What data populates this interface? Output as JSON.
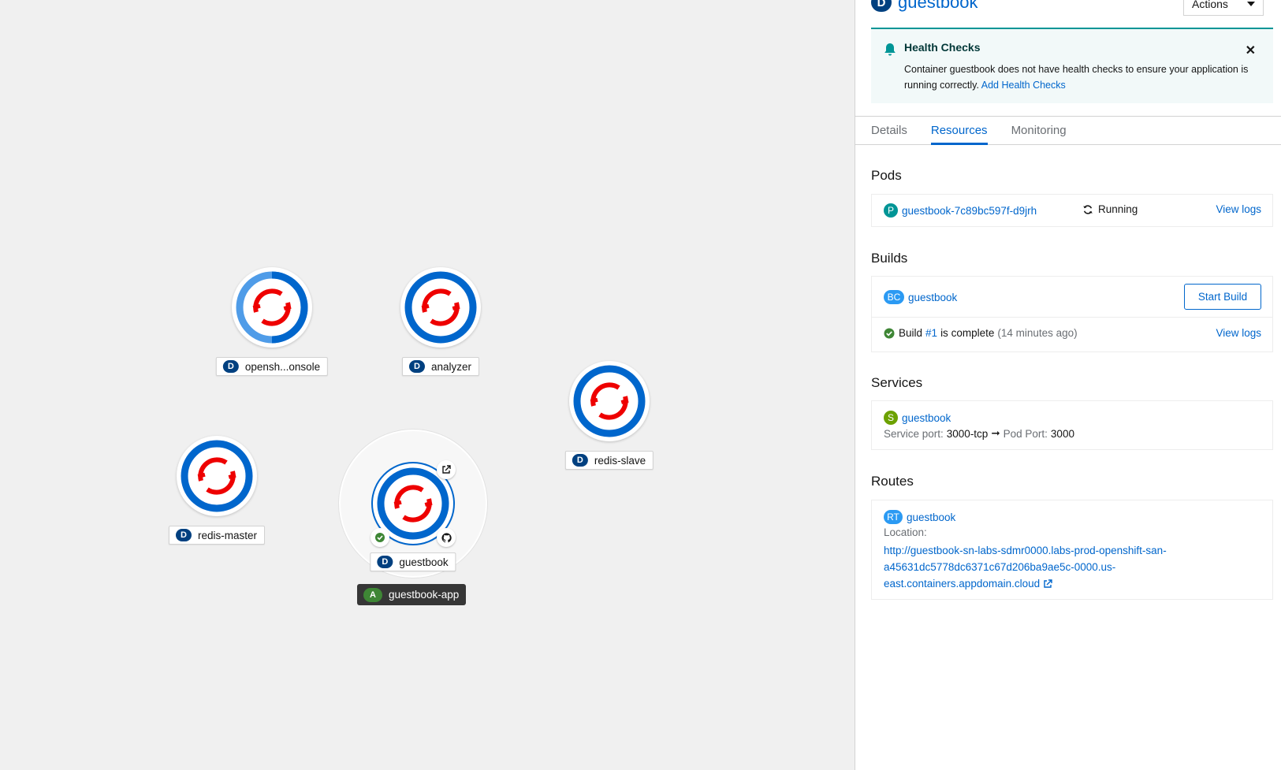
{
  "topology": {
    "nodes": [
      {
        "id": "openshift-console",
        "badge": "D",
        "label": "opensh...onsole"
      },
      {
        "id": "analyzer",
        "badge": "D",
        "label": "analyzer"
      },
      {
        "id": "redis-slave",
        "badge": "D",
        "label": "redis-slave"
      },
      {
        "id": "redis-master",
        "badge": "D",
        "label": "redis-master"
      },
      {
        "id": "guestbook",
        "badge": "D",
        "label": "guestbook"
      }
    ],
    "application": {
      "badge": "A",
      "label": "guestbook-app"
    }
  },
  "panel": {
    "title_badge": "D",
    "title": "guestbook",
    "actions_label": "Actions",
    "alert": {
      "title": "Health Checks",
      "body": "Container guestbook does not have health checks to ensure your application is running correctly.",
      "link": "Add Health Checks"
    },
    "tabs": [
      {
        "label": "Details",
        "active": false
      },
      {
        "label": "Resources",
        "active": true
      },
      {
        "label": "Monitoring",
        "active": false
      }
    ],
    "pods": {
      "heading": "Pods",
      "badge": "P",
      "name": "guestbook-7c89bc597f-d9jrh",
      "status": "Running",
      "logs_link": "View logs"
    },
    "builds": {
      "heading": "Builds",
      "badge": "BC",
      "name": "guestbook",
      "start_button": "Start Build",
      "build_prefix": "Build",
      "build_number": "#1",
      "build_status": "is complete",
      "build_time": "(14 minutes ago)",
      "logs_link": "View logs"
    },
    "services": {
      "heading": "Services",
      "badge": "S",
      "name": "guestbook",
      "service_port_label": "Service port:",
      "service_port": "3000-tcp",
      "arrow": "➞",
      "pod_port_label": "Pod Port:",
      "pod_port": "3000"
    },
    "routes": {
      "heading": "Routes",
      "badge": "RT",
      "name": "guestbook",
      "location_label": "Location:",
      "url_line1": "http://guestbook-sn-labs-sdmr0000.labs-prod-openshift-san-",
      "url_line2": "a45631dc5778dc6371c67d206ba9ae5c-0000.us-",
      "url_line3": "east.containers.appdomain.cloud"
    }
  },
  "colors": {
    "accent": "#0066cc",
    "deployment_badge": "#004080",
    "pod_badge": "#009596",
    "build_badge": "#2b9af3",
    "service_badge": "#6ca100",
    "app_badge": "#3e8635",
    "alert_bg": "#f2f9f9",
    "openshift_red": "#ee0000"
  }
}
